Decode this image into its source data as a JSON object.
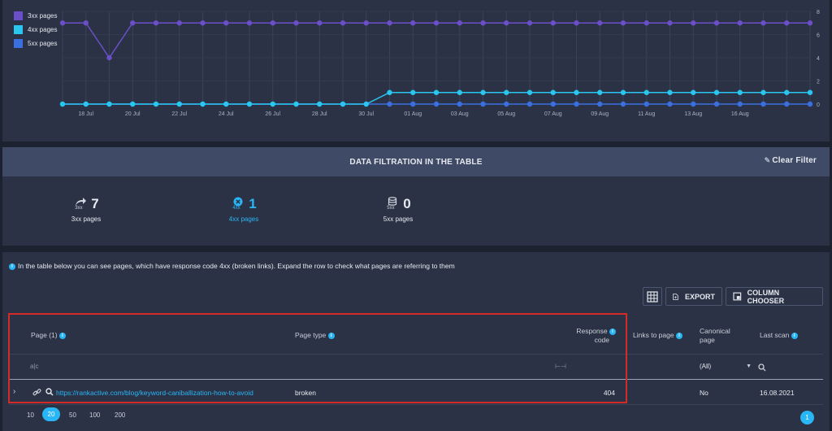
{
  "chart_data": {
    "type": "line",
    "x_tick_labels": [
      "18 Jul",
      "20 Jul",
      "22 Jul",
      "24 Jul",
      "26 Jul",
      "28 Jul",
      "30 Jul",
      "01 Aug",
      "03 Aug",
      "05 Aug",
      "07 Aug",
      "09 Aug",
      "11 Aug",
      "13 Aug",
      "16 Aug"
    ],
    "y_tick_labels": [
      "0",
      "2",
      "4",
      "6",
      "8"
    ],
    "ylim": [
      0,
      8
    ],
    "grid": true,
    "legend_position": "top-left",
    "series": [
      {
        "name": "3xx pages",
        "color": "#6a4fc8",
        "values": [
          7,
          7,
          4,
          7,
          7,
          7,
          7,
          7,
          7,
          7,
          7,
          7,
          7,
          7,
          7,
          7,
          7,
          7,
          7,
          7,
          7,
          7,
          7,
          7,
          7,
          7,
          7,
          7,
          7,
          7,
          7,
          7,
          7
        ]
      },
      {
        "name": "4xx pages",
        "color": "#29c6f0",
        "values": [
          0,
          0,
          0,
          0,
          0,
          0,
          0,
          0,
          0,
          0,
          0,
          0,
          0,
          0,
          1,
          1,
          1,
          1,
          1,
          1,
          1,
          1,
          1,
          1,
          1,
          1,
          1,
          1,
          1,
          1,
          1,
          1,
          1
        ]
      },
      {
        "name": "5xx pages",
        "color": "#3a6fe0",
        "values": [
          0,
          0,
          0,
          0,
          0,
          0,
          0,
          0,
          0,
          0,
          0,
          0,
          0,
          0,
          0,
          0,
          0,
          0,
          0,
          0,
          0,
          0,
          0,
          0,
          0,
          0,
          0,
          0,
          0,
          0,
          0,
          0,
          0
        ]
      }
    ]
  },
  "filter": {
    "title": "DATA FILTRATION IN THE TABLE",
    "clear_label": "Clear Filter",
    "stats": [
      {
        "count": "7",
        "label": "3xx pages",
        "sub": "3xx",
        "icon": "redirect-arrow-icon"
      },
      {
        "count": "1",
        "label": "4xx pages",
        "sub": "4xx",
        "icon": "error-circle-icon",
        "color": "#29b6f6"
      },
      {
        "count": "0",
        "label": "5xx pages",
        "sub": "5xx",
        "icon": "server-icon"
      }
    ]
  },
  "table": {
    "info_text": "In the table below you can see pages, which have response code 4xx (broken links). Expand the row to check what pages are referring to them",
    "export_label": "EXPORT",
    "column_chooser_label": "COLUMN CHOOSER",
    "columns": {
      "page": "Page (1)",
      "page_type": "Page type",
      "response_code_line1": "Response",
      "response_code_line2": "code",
      "links_to_page": "Links to page",
      "canonical_line1": "Canonical",
      "canonical_line2": "page",
      "last_scan": "Last scan"
    },
    "filter_row": {
      "canonical_value": "(All)"
    },
    "rows": [
      {
        "url": "https://rankactive.com/blog/keyword-caniballization-how-to-avoid",
        "page_type": "broken",
        "response_code": "404",
        "canonical": "No",
        "last_scan": "16.08.2021"
      }
    ],
    "page_sizes": [
      "10",
      "20",
      "50",
      "100",
      "200"
    ],
    "active_page_size": "20",
    "current_page": "1"
  }
}
